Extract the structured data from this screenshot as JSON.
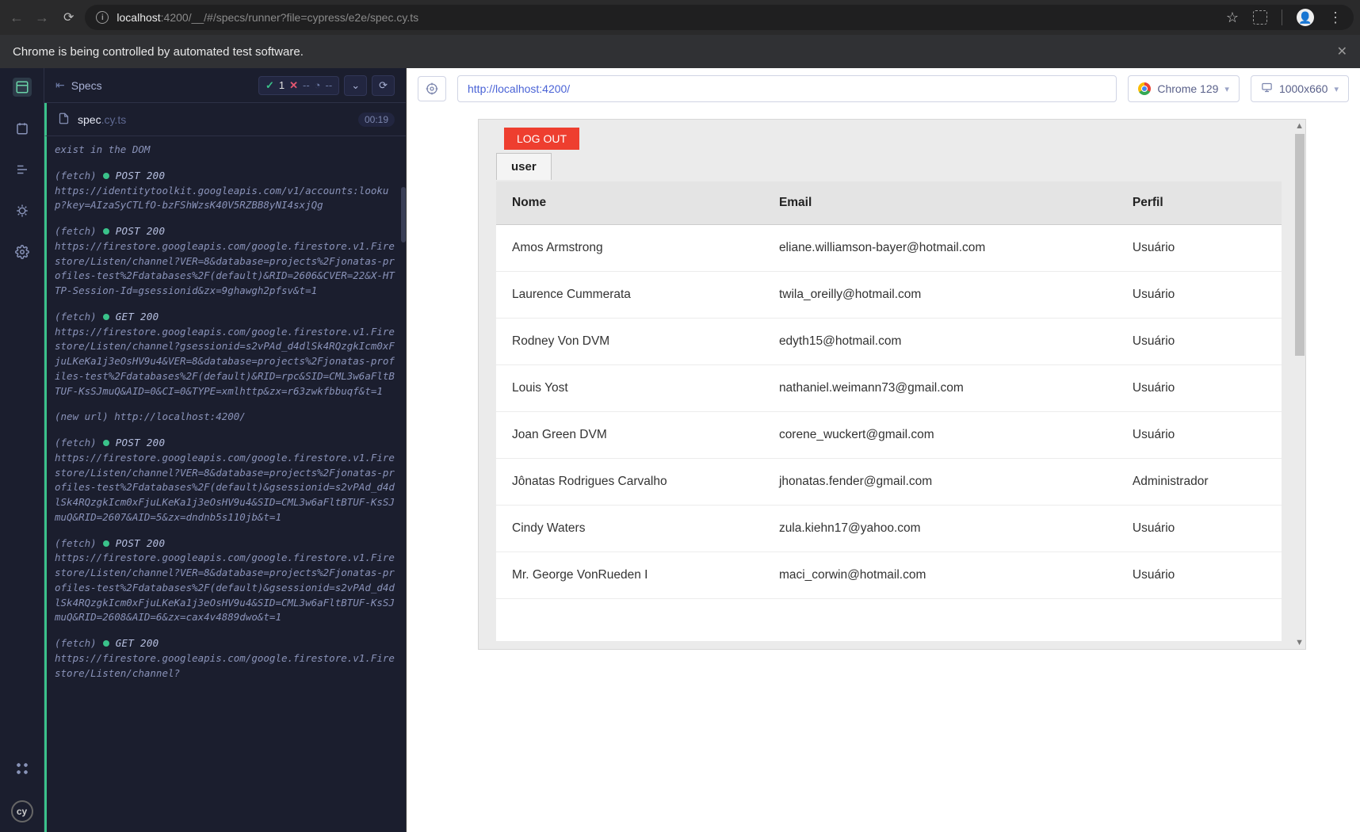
{
  "browser": {
    "url_host": "localhost",
    "url_path": ":4200/__/#/specs/runner?file=cypress/e2e/spec.cy.ts"
  },
  "banner": {
    "text": "Chrome is being controlled by automated test software."
  },
  "cypress": {
    "header_label": "Specs",
    "stats": {
      "pass": "1",
      "fail_dash": "--",
      "pending_dash": "--"
    },
    "spec": {
      "name": "spec",
      "ext": ".cy.ts",
      "time": "00:19"
    },
    "logs": [
      {
        "type": "plain",
        "text": "exist in the DOM"
      },
      {
        "type": "fetch",
        "method": "POST 200",
        "url": "https://identitytoolkit.googleapis.com/v1/accounts:lookup?key=AIzaSyCTLfO-bzFShWzsK40V5RZBB8yNI4sxjQg"
      },
      {
        "type": "fetch",
        "method": "POST 200",
        "url": "https://firestore.googleapis.com/google.firestore.v1.Firestore/Listen/channel?VER=8&database=projects%2Fjonatas-profiles-test%2Fdatabases%2F(default)&RID=2606&CVER=22&X-HTTP-Session-Id=gsessionid&zx=9ghawgh2pfsv&t=1"
      },
      {
        "type": "fetch",
        "method": "GET 200",
        "url": "https://firestore.googleapis.com/google.firestore.v1.Firestore/Listen/channel?gsessionid=s2vPAd_d4dlSk4RQzgkIcm0xFjuLKeKa1j3eOsHV9u4&VER=8&database=projects%2Fjonatas-profiles-test%2Fdatabases%2F(default)&RID=rpc&SID=CML3w6aFltBTUF-KsSJmuQ&AID=0&CI=0&TYPE=xmlhttp&zx=r63zwkfbbuqf&t=1"
      },
      {
        "type": "newurl",
        "text": "(new url)  http://localhost:4200/"
      },
      {
        "type": "fetch",
        "method": "POST 200",
        "url": "https://firestore.googleapis.com/google.firestore.v1.Firestore/Listen/channel?VER=8&database=projects%2Fjonatas-profiles-test%2Fdatabases%2F(default)&gsessionid=s2vPAd_d4dlSk4RQzgkIcm0xFjuLKeKa1j3eOsHV9u4&SID=CML3w6aFltBTUF-KsSJmuQ&RID=2607&AID=5&zx=dndnb5s110jb&t=1"
      },
      {
        "type": "fetch",
        "method": "POST 200",
        "url": "https://firestore.googleapis.com/google.firestore.v1.Firestore/Listen/channel?VER=8&database=projects%2Fjonatas-profiles-test%2Fdatabases%2F(default)&gsessionid=s2vPAd_d4dlSk4RQzgkIcm0xFjuLKeKa1j3eOsHV9u4&SID=CML3w6aFltBTUF-KsSJmuQ&RID=2608&AID=6&zx=cax4v4889dwo&t=1"
      },
      {
        "type": "fetch",
        "method": "GET 200",
        "url": "https://firestore.googleapis.com/google.firestore.v1.Firestore/Listen/channel?"
      }
    ]
  },
  "preview": {
    "url": "http://localhost:4200/",
    "browser_pill": "Chrome 129",
    "viewport_pill": "1000x660",
    "logout": "LOG OUT",
    "tab": "user",
    "columns": {
      "nome": "Nome",
      "email": "Email",
      "perfil": "Perfil"
    },
    "rows": [
      {
        "nome": "Amos Armstrong",
        "email": "eliane.williamson-bayer@hotmail.com",
        "perfil": "Usuário"
      },
      {
        "nome": "Laurence Cummerata",
        "email": "twila_oreilly@hotmail.com",
        "perfil": "Usuário"
      },
      {
        "nome": "Rodney Von DVM",
        "email": "edyth15@hotmail.com",
        "perfil": "Usuário"
      },
      {
        "nome": "Louis Yost",
        "email": "nathaniel.weimann73@gmail.com",
        "perfil": "Usuário"
      },
      {
        "nome": "Joan Green DVM",
        "email": "corene_wuckert@gmail.com",
        "perfil": "Usuário"
      },
      {
        "nome": "Jônatas Rodrigues Carvalho",
        "email": "jhonatas.fender@gmail.com",
        "perfil": "Administrador"
      },
      {
        "nome": "Cindy Waters",
        "email": "zula.kiehn17@yahoo.com",
        "perfil": "Usuário"
      },
      {
        "nome": "Mr. George VonRueden I",
        "email": "maci_corwin@hotmail.com",
        "perfil": "Usuário"
      }
    ]
  }
}
